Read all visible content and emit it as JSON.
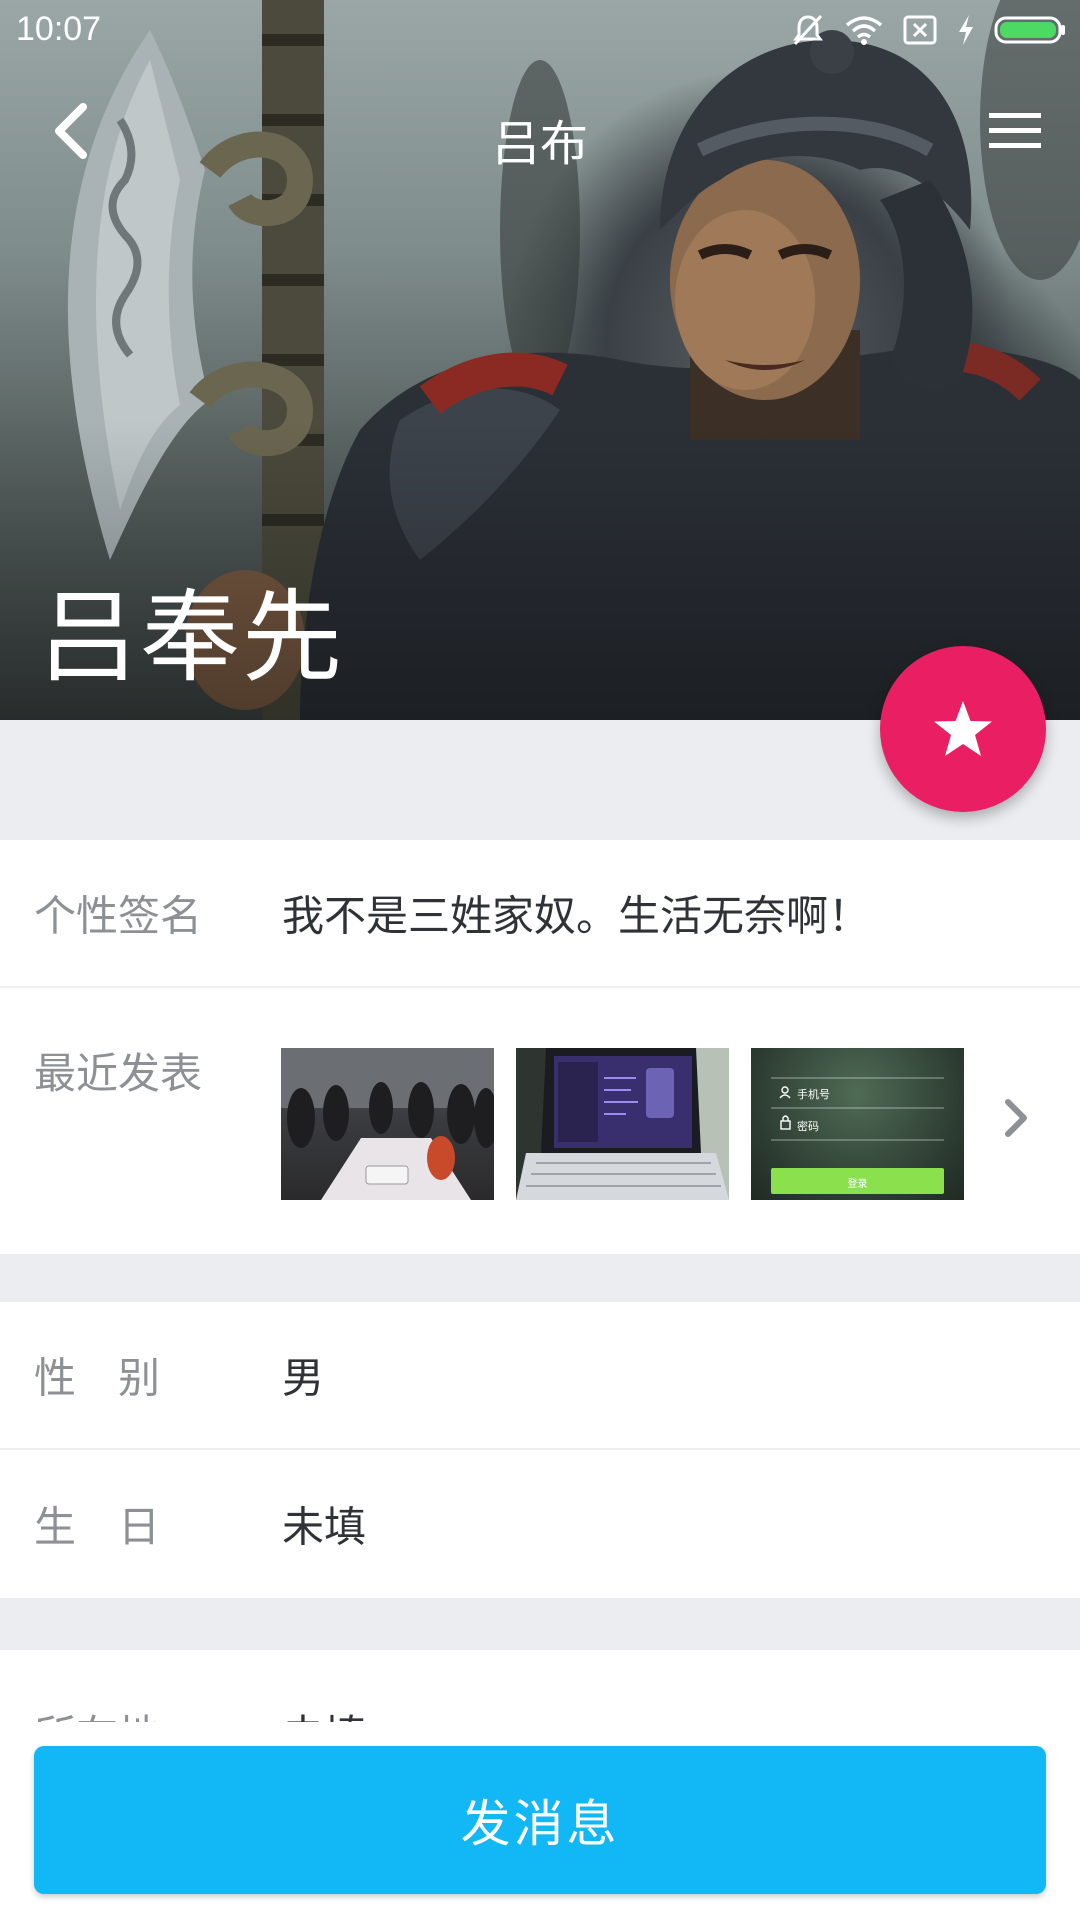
{
  "status_bar": {
    "time": "10:07",
    "icons": [
      "silent-icon",
      "wifi-icon",
      "sim-icon",
      "charging-icon",
      "battery-icon"
    ],
    "battery_color": "#4cd964"
  },
  "toolbar": {
    "title": "吕布",
    "back_icon": "chevron-left-icon",
    "menu_icon": "hamburger-menu-icon"
  },
  "hero": {
    "name": "吕奉先"
  },
  "fab": {
    "icon": "star-icon",
    "color": "#e91e63"
  },
  "profile": {
    "signature_label": "个性签名",
    "signature_value": "我不是三姓家奴。生活无奈啊！",
    "recent_posts_label": "最近发表",
    "recent_posts": [
      {
        "name": "post-thumbnail-event"
      },
      {
        "name": "post-thumbnail-laptop"
      },
      {
        "name": "post-thumbnail-login-screen",
        "phone_hint": "手机号",
        "password_hint": "密码",
        "login_button": "登录"
      }
    ]
  },
  "details": {
    "gender_label": "性　别",
    "gender_value": "男",
    "birthday_label": "生　日",
    "birthday_value": "未填",
    "location_label": "所在地",
    "location_value": "未填"
  },
  "actions": {
    "send_message": "发消息",
    "send_color": "#12b7f5"
  }
}
